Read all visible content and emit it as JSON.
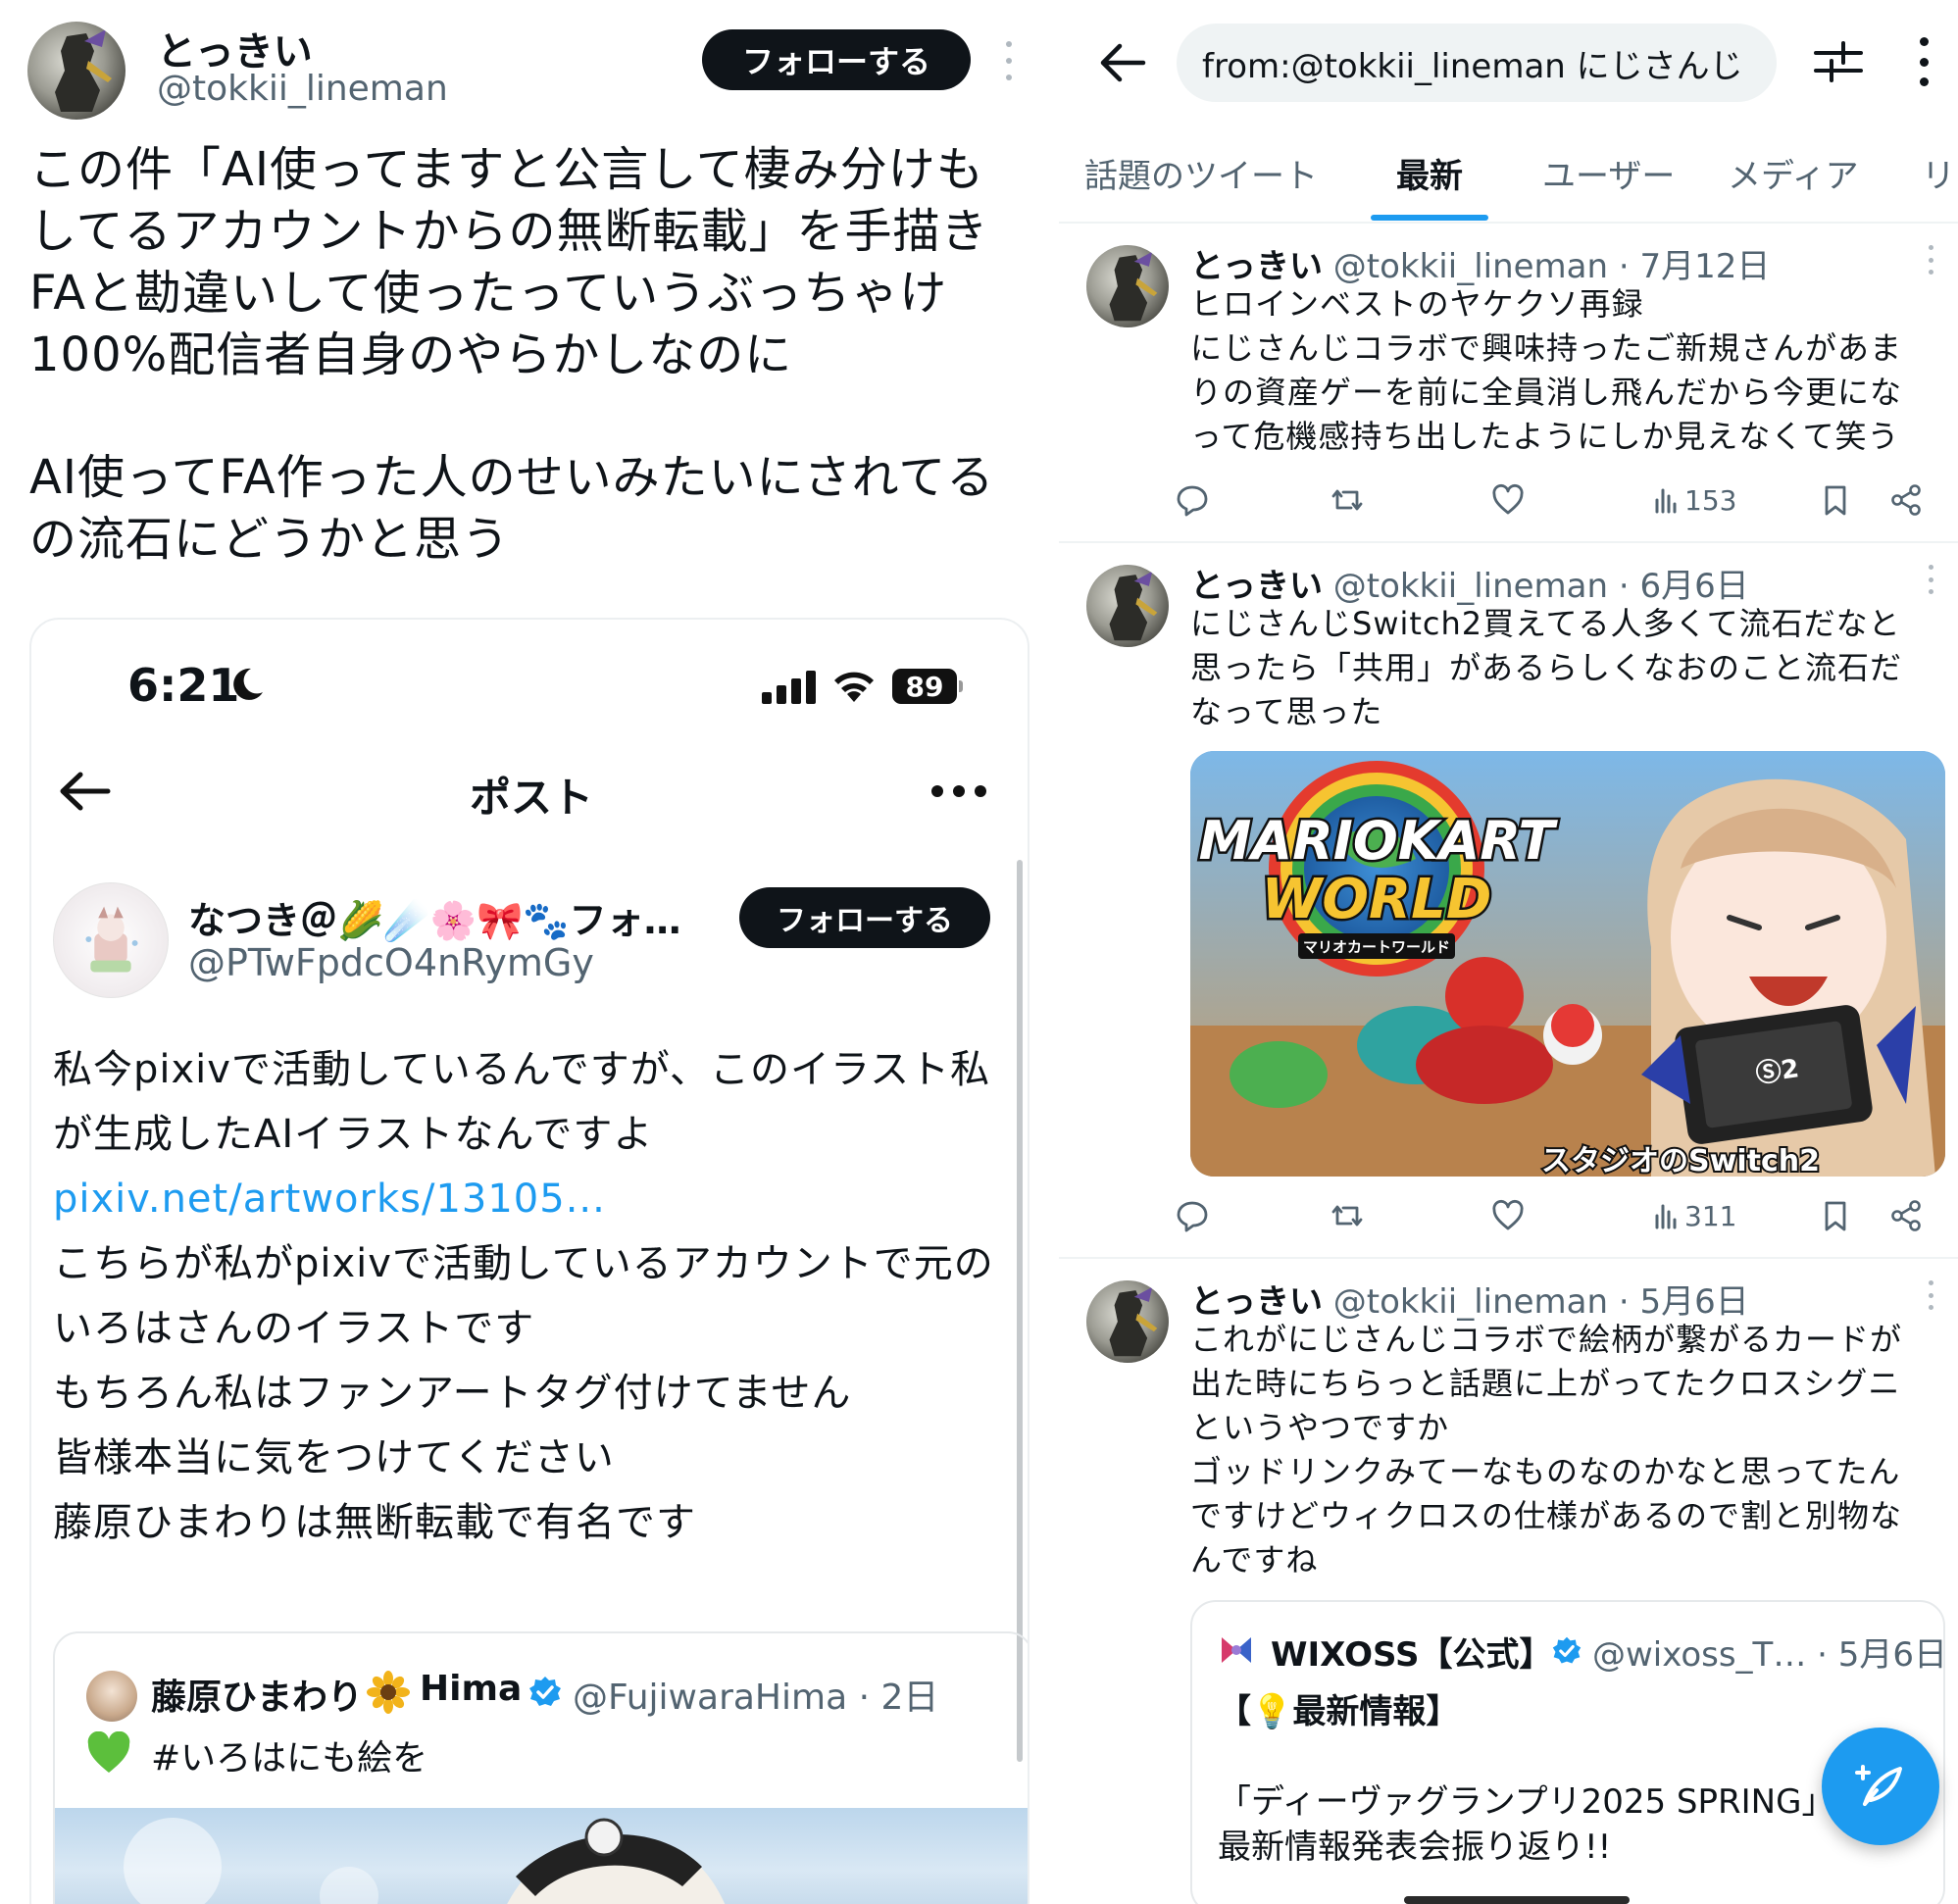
{
  "left_tweet": {
    "author_name": "とっきい",
    "author_handle": "@tokkii_lineman",
    "follow_label": "フォローする",
    "body_p1": "この件「AI使ってますと公言して棲み分けもしてるアカウントからの無断転載」を手描きFAと勘違いして使ったっていうぶっちゃけ100%配信者自身のやらかしなのに",
    "body_p2": "AI使ってFA作った人のせいみたいにされてるの流石にどうかと思う"
  },
  "embedded": {
    "status_time": "6:21",
    "battery": "89",
    "header_title": "ポスト",
    "author_name": "なつき＠🌽☄️🌸🎀🐾フォ…",
    "author_handle": "@PTwFpdcO4nRymGy",
    "follow_label": "フォローする",
    "body_lines": [
      "私今pixivで活動しているんですが、このイラスト私",
      "が生成したAIイラストなんですよ",
      "pixiv.net/artworks/13105...",
      "こちらが私がpixivで活動しているアカウントで元の",
      "いろはさんのイラストです",
      "もちろん私はファンアートタグ付けてません",
      "皆様本当に気をつけてください",
      "藤原ひまわりは無断転載で有名です"
    ],
    "quote": {
      "author_name": "藤原ひまわり",
      "author_suffix": "Hima",
      "author_handle": "@FujiwaraHima · 2日",
      "text": "#いろはにも絵を"
    }
  },
  "search_pane": {
    "search_query": "from:@tokkii_lineman にじさんじ",
    "tabs": [
      "話題のツイート",
      "最新",
      "ユーザー",
      "メディア",
      "リ"
    ],
    "active_tab": "最新",
    "tweets": [
      {
        "name": "とっきい",
        "meta": "@tokkii_lineman · 7月12日",
        "lines": [
          "ヒロインベストのヤケクソ再録",
          "にじさんじコラボで興味持ったご新規さんがあま",
          "りの資産ゲーを前に全員消し飛んだから今更にな",
          "って危機感持ち出したようにしか見えなくて笑う"
        ],
        "views": "153"
      },
      {
        "name": "とっきい",
        "meta": "@tokkii_lineman · 6月6日",
        "lines": [
          "にじさんじSwitch2買えてる人多くて流石だなと",
          "思ったら「共用」があるらしくなおのこと流石だ",
          "なって思った"
        ],
        "image_title_1": "MARIOKART",
        "image_title_2": "WORLD",
        "image_subtitle": "マリオカートワールド",
        "image_caption": "スタジオのSwitch2",
        "image_console": "Ⓢ2",
        "views": "311"
      },
      {
        "name": "とっきい",
        "meta": "@tokkii_lineman · 5月6日",
        "lines": [
          "これがにじさんじコラボで絵柄が繋がるカードが",
          "出た時にちらっと話題に上がってたクロスシグニ",
          "というやつですか",
          "ゴッドリンクみてーなものなのかなと思ってたん",
          "ですけどウィクロスの仕様があるので割と別物な",
          "んですね"
        ],
        "quote": {
          "name": "WIXOSS【公式】",
          "handle": "@wixoss_T… · 5月6日",
          "line1": "【💡最新情報】",
          "line2": "「ディーヴァグランプリ2025 SPRING」",
          "line3": "最新情報発表会振り返り!!"
        }
      }
    ]
  },
  "colors": {
    "accent": "#1d9bf0",
    "text": "#0f1419",
    "muted": "#536471",
    "follow_bg": "#0f1419"
  }
}
